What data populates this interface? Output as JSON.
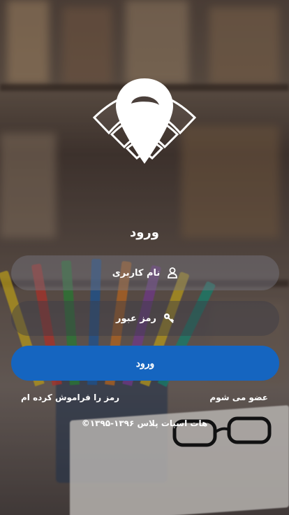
{
  "header": {
    "title": "ورود"
  },
  "login": {
    "username_placeholder": "نام کاربری",
    "password_placeholder": "رمز عبور",
    "submit_label": "ورود"
  },
  "links": {
    "forgot": "رمز را فراموش کرده ام",
    "join": "عضو می شوم"
  },
  "footer": {
    "copyright": "©۱۳۹۵-۱۳۹۶ هات اسپات پلاس"
  },
  "colors": {
    "primary": "#1565c0"
  },
  "icons": {
    "user": "user-icon",
    "key": "key-icon",
    "logo": "location-wifi-logo"
  }
}
